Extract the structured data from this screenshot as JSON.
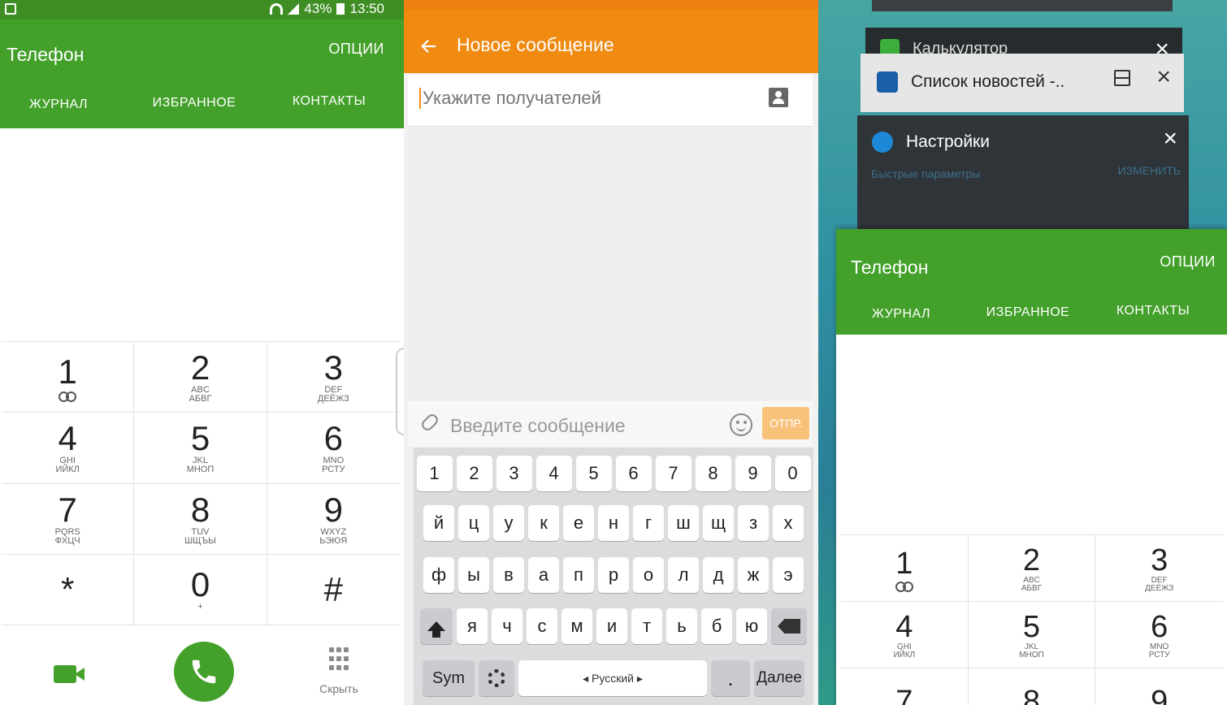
{
  "left_phone": {
    "status": {
      "battery": "43%",
      "time": "13:50"
    },
    "title": "Телефон",
    "options": "ОПЦИИ",
    "tabs": [
      "ЖУРНАЛ",
      "ИЗБРАННОЕ",
      "КОНТАКТЫ"
    ],
    "keys": [
      {
        "d": "1",
        "s": ""
      },
      {
        "d": "2",
        "s": "ABC\nАБВГ"
      },
      {
        "d": "3",
        "s": "DEF\nДЕЁЖЗ"
      },
      {
        "d": "4",
        "s": "GHI\nИЙКЛ"
      },
      {
        "d": "5",
        "s": "JKL\nМНОП"
      },
      {
        "d": "6",
        "s": "MNO\nРСТУ"
      },
      {
        "d": "7",
        "s": "PQRS\nФХЦЧ"
      },
      {
        "d": "8",
        "s": "TUV\nШЩЪЫ"
      },
      {
        "d": "9",
        "s": "WXYZ\nЬЭЮЯ"
      },
      {
        "d": "*",
        "s": ""
      },
      {
        "d": "0",
        "s": "+"
      },
      {
        "d": "#",
        "s": ""
      }
    ],
    "hide_label": "Скрыть"
  },
  "message": {
    "title": "Новое сообщение",
    "recipients_placeholder": "Укажите получателей",
    "compose_placeholder": "Введите сообщение",
    "send_label": "ОТПР.",
    "keyboard": {
      "numbers": [
        "1",
        "2",
        "3",
        "4",
        "5",
        "6",
        "7",
        "8",
        "9",
        "0"
      ],
      "row1": [
        "й",
        "ц",
        "у",
        "к",
        "е",
        "н",
        "г",
        "ш",
        "щ",
        "з",
        "х"
      ],
      "row2": [
        "ф",
        "ы",
        "в",
        "а",
        "п",
        "р",
        "о",
        "л",
        "д",
        "ж",
        "э"
      ],
      "row3": [
        "я",
        "ч",
        "с",
        "м",
        "и",
        "т",
        "ь",
        "б",
        "ю"
      ],
      "sym": "Sym",
      "language": "◂ Русский ▸",
      "next": "Далее"
    }
  },
  "recents": {
    "calculator": "Калькулятор",
    "news": "Список новостей -..",
    "settings": "Настройки",
    "quick_settings": "Быстрые параметры",
    "edit": "ИЗМЕНИТЬ",
    "phone": {
      "title": "Телефон",
      "options": "ОПЦИИ",
      "tabs": [
        "ЖУРНАЛ",
        "ИЗБРАННОЕ",
        "КОНТАКТЫ"
      ],
      "keys": [
        {
          "d": "1",
          "s": ""
        },
        {
          "d": "2",
          "s": "ABC\nАБВГ"
        },
        {
          "d": "3",
          "s": "DEF\nДЕЁЖЗ"
        },
        {
          "d": "4",
          "s": "GHI\nИЙКЛ"
        },
        {
          "d": "5",
          "s": "JKL\nМНОП"
        },
        {
          "d": "6",
          "s": "MNO\nРСТУ"
        },
        {
          "d": "7",
          "s": ""
        },
        {
          "d": "8",
          "s": ""
        },
        {
          "d": "9",
          "s": ""
        }
      ]
    }
  },
  "colors": {
    "green": "#43a02a",
    "orange": "#f08a11"
  }
}
